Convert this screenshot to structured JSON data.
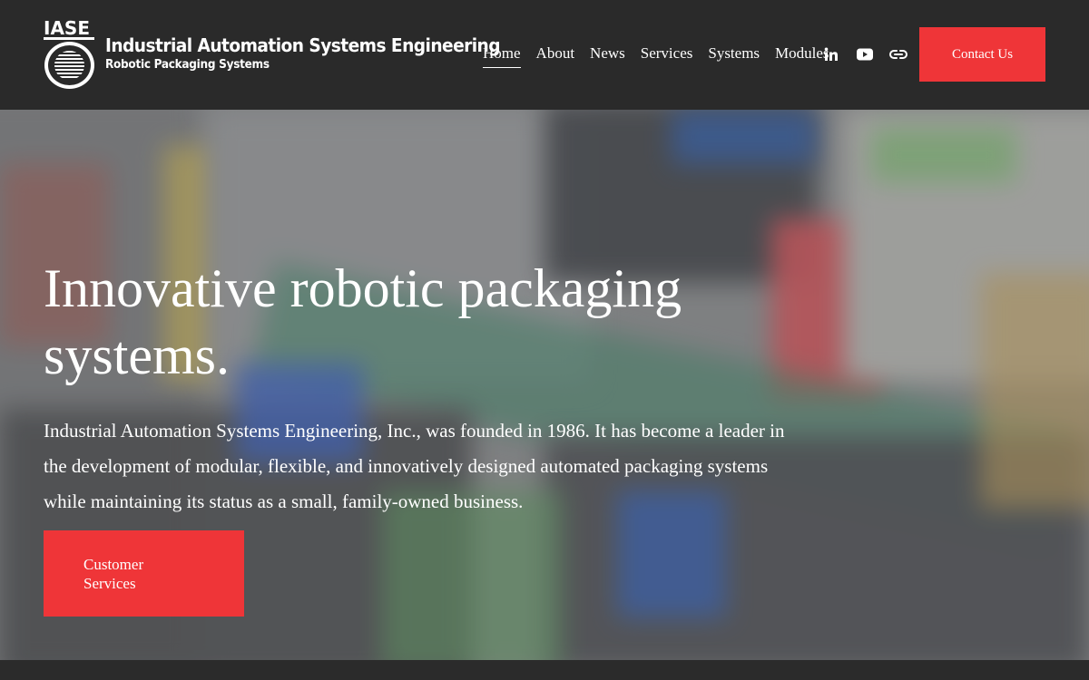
{
  "logo": {
    "abbr": "IASE",
    "title": "Industrial Automation Systems Engineering",
    "subtitle": "Robotic Packaging Systems"
  },
  "nav": {
    "items": [
      {
        "label": "Home",
        "active": true
      },
      {
        "label": "About"
      },
      {
        "label": "News"
      },
      {
        "label": "Services"
      },
      {
        "label": "Systems"
      },
      {
        "label": "Modules"
      }
    ]
  },
  "social": {
    "icons": [
      "linkedin-icon",
      "youtube-icon",
      "link-icon"
    ]
  },
  "header": {
    "contact_label": "Contact Us"
  },
  "hero": {
    "title": "Innovative robotic packaging systems.",
    "text": "Industrial Automation Systems Engineering, Inc., was founded in 1986. It has become a leader in the development of modular, flexible, and innovatively designed automated packaging systems while maintaining its status as a small, family-owned business.",
    "button_label": "Customer Services"
  },
  "colors": {
    "header_bg": "#2a2a2a",
    "accent": "#ef3538",
    "text": "#ffffff"
  }
}
